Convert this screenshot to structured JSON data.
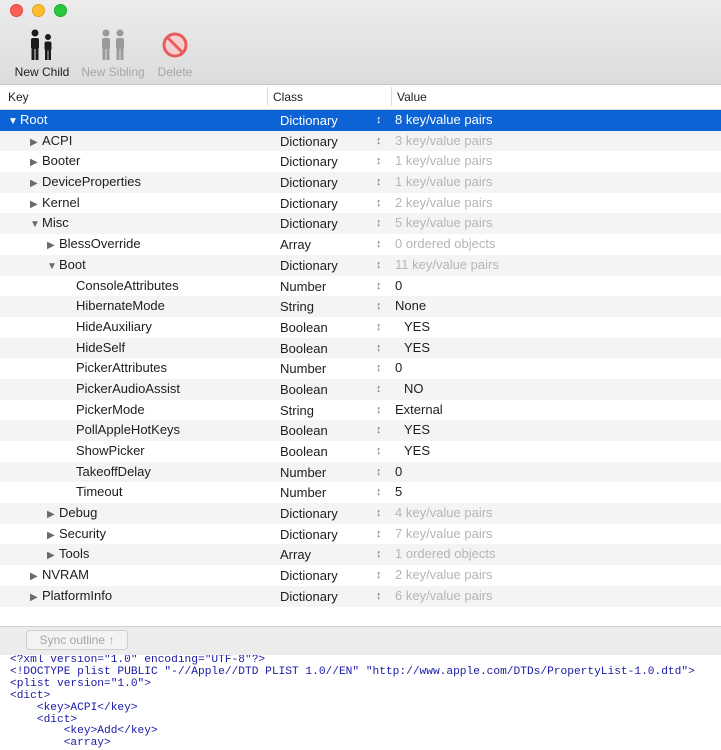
{
  "toolbar": {
    "new_child": "New Child",
    "new_sibling": "New Sibling",
    "delete": "Delete"
  },
  "columns": {
    "key": "Key",
    "class": "Class",
    "value": "Value"
  },
  "rows": [
    {
      "key": "Root",
      "class": "Dictionary",
      "value": "8 key/value pairs",
      "indent": 0,
      "tri": "open",
      "sel": true,
      "dim": false
    },
    {
      "key": "ACPI",
      "class": "Dictionary",
      "value": "3 key/value pairs",
      "indent": 1,
      "tri": "closed",
      "dim": true
    },
    {
      "key": "Booter",
      "class": "Dictionary",
      "value": "1 key/value pairs",
      "indent": 1,
      "tri": "closed",
      "dim": true
    },
    {
      "key": "DeviceProperties",
      "class": "Dictionary",
      "value": "1 key/value pairs",
      "indent": 1,
      "tri": "closed",
      "dim": true
    },
    {
      "key": "Kernel",
      "class": "Dictionary",
      "value": "2 key/value pairs",
      "indent": 1,
      "tri": "closed",
      "dim": true
    },
    {
      "key": "Misc",
      "class": "Dictionary",
      "value": "5 key/value pairs",
      "indent": 1,
      "tri": "open",
      "dim": true
    },
    {
      "key": "BlessOverride",
      "class": "Array",
      "value": "0 ordered objects",
      "indent": 2,
      "tri": "closed",
      "dim": true
    },
    {
      "key": "Boot",
      "class": "Dictionary",
      "value": "11 key/value pairs",
      "indent": 2,
      "tri": "open",
      "dim": true
    },
    {
      "key": "ConsoleAttributes",
      "class": "Number",
      "value": "0",
      "indent": 3,
      "tri": "none",
      "dim": false
    },
    {
      "key": "HibernateMode",
      "class": "String",
      "value": "None",
      "indent": 3,
      "tri": "none",
      "dim": false
    },
    {
      "key": "HideAuxiliary",
      "class": "Boolean",
      "value": "YES",
      "indent": 3,
      "tri": "none",
      "dim": false,
      "bool": true
    },
    {
      "key": "HideSelf",
      "class": "Boolean",
      "value": "YES",
      "indent": 3,
      "tri": "none",
      "dim": false,
      "bool": true
    },
    {
      "key": "PickerAttributes",
      "class": "Number",
      "value": "0",
      "indent": 3,
      "tri": "none",
      "dim": false
    },
    {
      "key": "PickerAudioAssist",
      "class": "Boolean",
      "value": "NO",
      "indent": 3,
      "tri": "none",
      "dim": false,
      "bool": true
    },
    {
      "key": "PickerMode",
      "class": "String",
      "value": "External",
      "indent": 3,
      "tri": "none",
      "dim": false
    },
    {
      "key": "PollAppleHotKeys",
      "class": "Boolean",
      "value": "YES",
      "indent": 3,
      "tri": "none",
      "dim": false,
      "bool": true
    },
    {
      "key": "ShowPicker",
      "class": "Boolean",
      "value": "YES",
      "indent": 3,
      "tri": "none",
      "dim": false,
      "bool": true
    },
    {
      "key": "TakeoffDelay",
      "class": "Number",
      "value": "0",
      "indent": 3,
      "tri": "none",
      "dim": false
    },
    {
      "key": "Timeout",
      "class": "Number",
      "value": "5",
      "indent": 3,
      "tri": "none",
      "dim": false
    },
    {
      "key": "Debug",
      "class": "Dictionary",
      "value": "4 key/value pairs",
      "indent": 2,
      "tri": "closed",
      "dim": true
    },
    {
      "key": "Security",
      "class": "Dictionary",
      "value": "7 key/value pairs",
      "indent": 2,
      "tri": "closed",
      "dim": true
    },
    {
      "key": "Tools",
      "class": "Array",
      "value": "1 ordered objects",
      "indent": 2,
      "tri": "closed",
      "dim": true
    },
    {
      "key": "NVRAM",
      "class": "Dictionary",
      "value": "2 key/value pairs",
      "indent": 1,
      "tri": "closed",
      "dim": true
    },
    {
      "key": "PlatformInfo",
      "class": "Dictionary",
      "value": "6 key/value pairs",
      "indent": 1,
      "tri": "closed",
      "dim": true
    }
  ],
  "sync_label": "Sync outline ↑",
  "xml_lines": [
    "<?xml version=\"1.0\" encoding=\"UTF-8\"?>",
    "<!DOCTYPE plist PUBLIC \"-//Apple//DTD PLIST 1.0//EN\" \"http://www.apple.com/DTDs/PropertyList-1.0.dtd\">",
    "<plist version=\"1.0\">",
    "<dict>",
    "    <key>ACPI</key>",
    "    <dict>",
    "        <key>Add</key>",
    "        <array>"
  ],
  "colors": {
    "selection": "#0b63d6",
    "accent_icon": "#1b1b1b",
    "disabled_icon": "#9a9a9a",
    "delete_icon": "#e85c5c"
  },
  "icons": {
    "new_child": "people-icon",
    "new_sibling": "people-icon",
    "delete": "no-entry-icon"
  }
}
